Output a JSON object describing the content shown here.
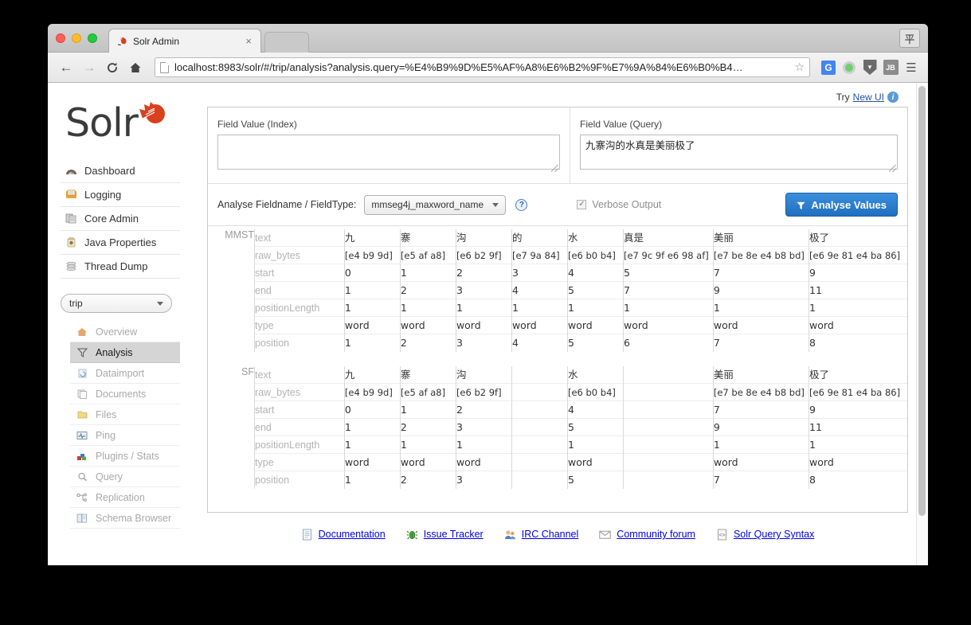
{
  "browser": {
    "tab": {
      "title": "Solr Admin",
      "favicon": "solr-favicon",
      "close": "×"
    },
    "url": "localhost:8983/solr/#/trip/analysis?analysis.query=%E4%B9%9D%E5%AF%A8%E6%B2%9F%E7%9A%84%E6%B0%B4…",
    "back": "←",
    "forward": "→",
    "reload": "C",
    "home": "⌂",
    "star": "☆",
    "extensions": [
      {
        "name": "google-translate-icon",
        "label": "G"
      },
      {
        "name": "green-dot-icon",
        "label": ""
      },
      {
        "name": "shield-icon",
        "label": "▾"
      },
      {
        "name": "jb-extension-icon",
        "label": "JB"
      },
      {
        "name": "browser-menu-icon",
        "label": "≡"
      }
    ],
    "ime": "平"
  },
  "header": {
    "try_text": "Try",
    "new_ui_link": "New UI",
    "info_icon": "i"
  },
  "logo": {
    "word": "Solr"
  },
  "sidebar": {
    "main_items": [
      {
        "label": "Dashboard",
        "icon": "dashboard-icon"
      },
      {
        "label": "Logging",
        "icon": "logging-icon"
      },
      {
        "label": "Core Admin",
        "icon": "core-admin-icon"
      },
      {
        "label": "Java Properties",
        "icon": "java-properties-icon"
      },
      {
        "label": "Thread Dump",
        "icon": "thread-dump-icon"
      }
    ],
    "core_selector": {
      "value": "trip"
    },
    "core_items": [
      {
        "label": "Overview",
        "icon": "home-icon",
        "active": false
      },
      {
        "label": "Analysis",
        "icon": "funnel-icon",
        "active": true
      },
      {
        "label": "Dataimport",
        "icon": "dataimport-icon",
        "active": false
      },
      {
        "label": "Documents",
        "icon": "documents-icon",
        "active": false
      },
      {
        "label": "Files",
        "icon": "folder-icon",
        "active": false
      },
      {
        "label": "Ping",
        "icon": "ping-icon",
        "active": false
      },
      {
        "label": "Plugins / Stats",
        "icon": "plugins-icon",
        "active": false
      },
      {
        "label": "Query",
        "icon": "magnifier-icon",
        "active": false
      },
      {
        "label": "Replication",
        "icon": "replication-icon",
        "active": false
      },
      {
        "label": "Schema Browser",
        "icon": "book-icon",
        "active": false
      }
    ]
  },
  "analysis": {
    "index_label": "Field Value (Index)",
    "index_value": "",
    "index_placeholder": "",
    "query_label": "Field Value (Query)",
    "query_value": "九寨沟的水真是美丽极了",
    "query_placeholder": "",
    "fieldname_label": "Analyse Fieldname / FieldType:",
    "fieldtype_value": "mmseg4j_maxword_name",
    "help_icon": "?",
    "verbose_label": "Verbose Output",
    "verbose_checked": true,
    "verbose_mark": "✓",
    "analyse_button": "Analyse Values"
  },
  "results": {
    "row_labels": [
      "text",
      "raw_bytes",
      "start",
      "end",
      "positionLength",
      "type",
      "position"
    ],
    "groups": [
      {
        "name": "MMST",
        "tokens": [
          {
            "text": "九",
            "raw_bytes": "[e4 b9 9d]",
            "start": "0",
            "end": "1",
            "positionLength": "1",
            "type": "word",
            "position": "1"
          },
          {
            "text": "寨",
            "raw_bytes": "[e5 af a8]",
            "start": "1",
            "end": "2",
            "positionLength": "1",
            "type": "word",
            "position": "2"
          },
          {
            "text": "沟",
            "raw_bytes": "[e6 b2 9f]",
            "start": "2",
            "end": "3",
            "positionLength": "1",
            "type": "word",
            "position": "3"
          },
          {
            "text": "的",
            "raw_bytes": "[e7 9a 84]",
            "start": "3",
            "end": "4",
            "positionLength": "1",
            "type": "word",
            "position": "4"
          },
          {
            "text": "水",
            "raw_bytes": "[e6 b0 b4]",
            "start": "4",
            "end": "5",
            "positionLength": "1",
            "type": "word",
            "position": "5"
          },
          {
            "text": "真是",
            "raw_bytes": "[e7 9c 9f e6 98 af]",
            "start": "5",
            "end": "7",
            "positionLength": "1",
            "type": "word",
            "position": "6"
          },
          {
            "text": "美丽",
            "raw_bytes": "[e7 be 8e e4 b8 bd]",
            "start": "7",
            "end": "9",
            "positionLength": "1",
            "type": "word",
            "position": "7"
          },
          {
            "text": "极了",
            "raw_bytes": "[e6 9e 81 e4 ba 86]",
            "start": "9",
            "end": "11",
            "positionLength": "1",
            "type": "word",
            "position": "8"
          }
        ]
      },
      {
        "name": "SF",
        "tokens": [
          {
            "text": "九",
            "raw_bytes": "[e4 b9 9d]",
            "start": "0",
            "end": "1",
            "positionLength": "1",
            "type": "word",
            "position": "1"
          },
          {
            "text": "寨",
            "raw_bytes": "[e5 af a8]",
            "start": "1",
            "end": "2",
            "positionLength": "1",
            "type": "word",
            "position": "2"
          },
          {
            "text": "沟",
            "raw_bytes": "[e6 b2 9f]",
            "start": "2",
            "end": "3",
            "positionLength": "1",
            "type": "word",
            "position": "3"
          },
          {
            "text": "",
            "raw_bytes": "",
            "start": "",
            "end": "",
            "positionLength": "",
            "type": "",
            "position": ""
          },
          {
            "text": "水",
            "raw_bytes": "[e6 b0 b4]",
            "start": "4",
            "end": "5",
            "positionLength": "1",
            "type": "word",
            "position": "5"
          },
          {
            "text": "",
            "raw_bytes": "",
            "start": "",
            "end": "",
            "positionLength": "",
            "type": "",
            "position": ""
          },
          {
            "text": "美丽",
            "raw_bytes": "[e7 be 8e e4 b8 bd]",
            "start": "7",
            "end": "9",
            "positionLength": "1",
            "type": "word",
            "position": "7"
          },
          {
            "text": "极了",
            "raw_bytes": "[e6 9e 81 e4 ba 86]",
            "start": "9",
            "end": "11",
            "positionLength": "1",
            "type": "word",
            "position": "8"
          }
        ]
      }
    ]
  },
  "footer": {
    "links": [
      {
        "label": "Documentation",
        "icon": "document-icon"
      },
      {
        "label": "Issue Tracker",
        "icon": "bug-icon"
      },
      {
        "label": "IRC Channel",
        "icon": "people-icon"
      },
      {
        "label": "Community forum",
        "icon": "envelope-icon"
      },
      {
        "label": "Solr Query Syntax",
        "icon": "code-icon"
      }
    ]
  },
  "colors": {
    "accent_blue": "#2074c7",
    "solr_red": "#d9411e",
    "active_nav": "#d5d5d5"
  }
}
